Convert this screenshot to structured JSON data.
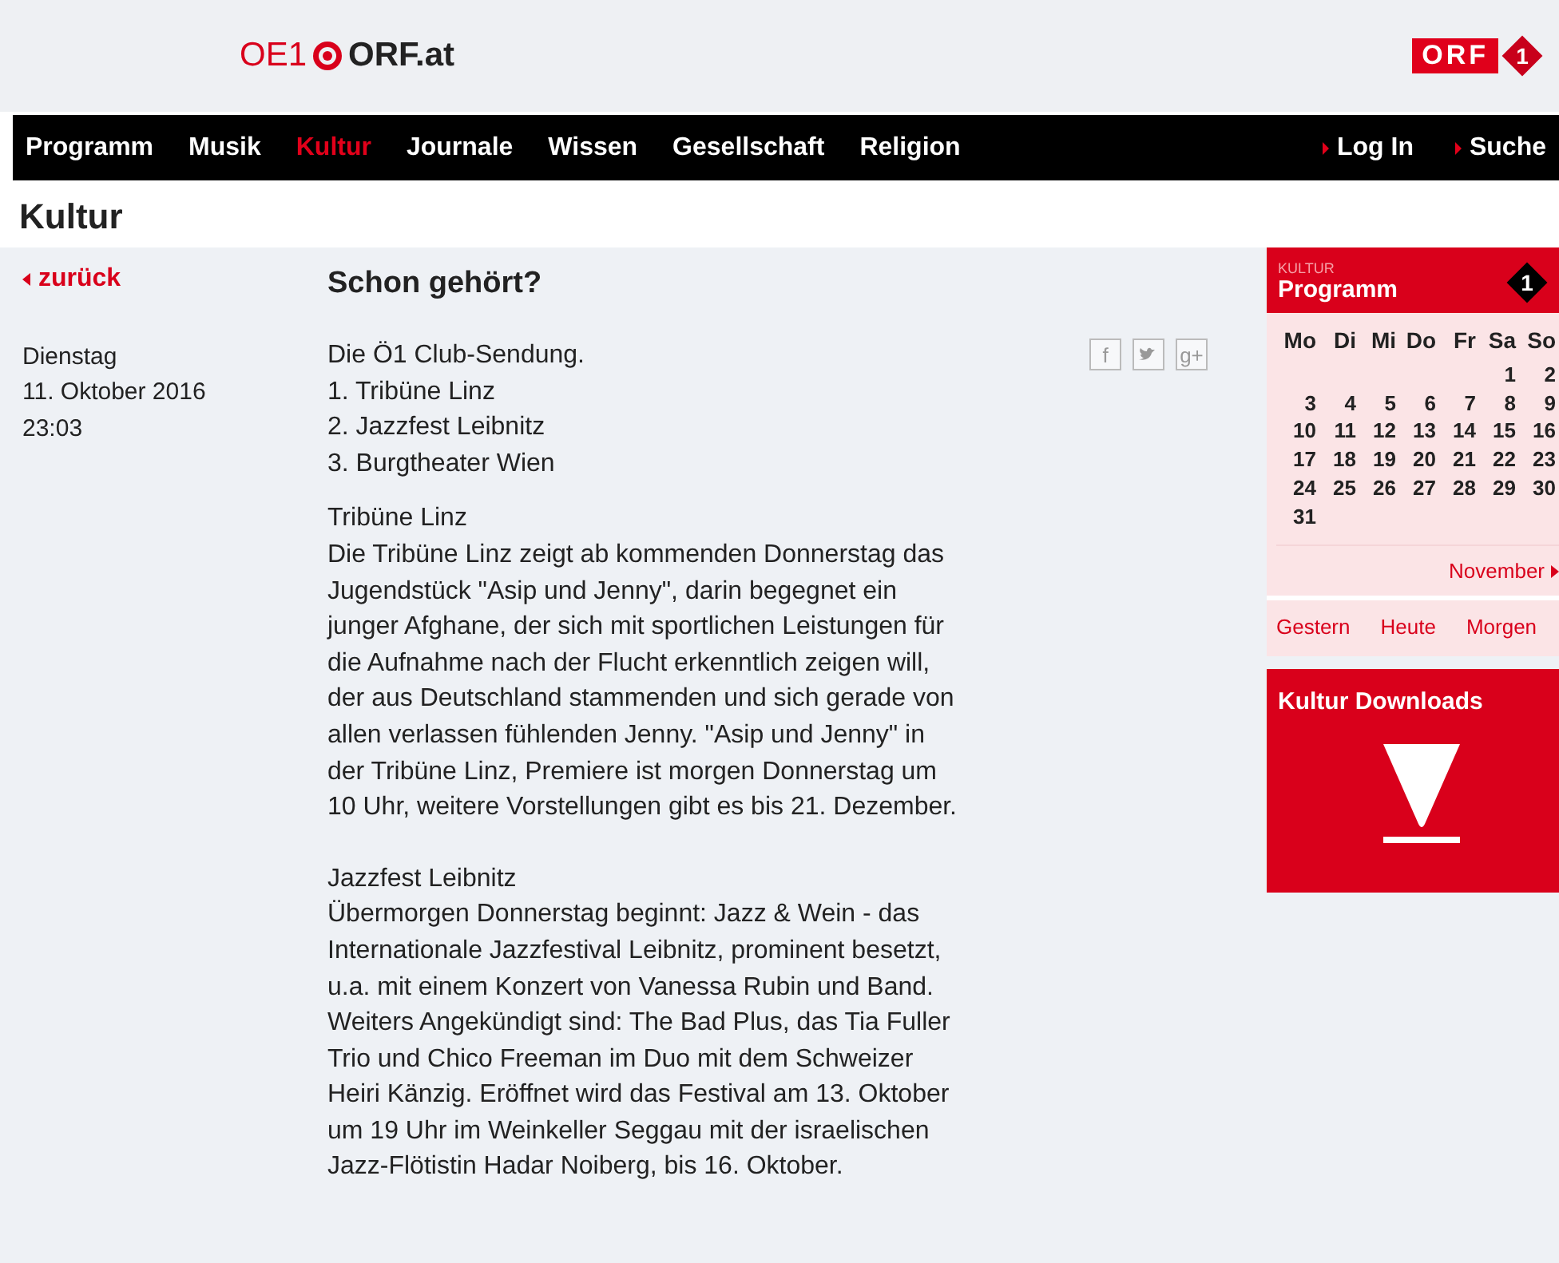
{
  "header": {
    "logo_left": "OE1",
    "logo_right": "ORF.at",
    "brand_badge": "ORF",
    "brand_number": "1"
  },
  "nav": {
    "items": [
      {
        "label": "Programm",
        "selected": false
      },
      {
        "label": "Musik",
        "selected": false
      },
      {
        "label": "Kultur",
        "selected": true
      },
      {
        "label": "Journale",
        "selected": false
      },
      {
        "label": "Wissen",
        "selected": false
      },
      {
        "label": "Gesellschaft",
        "selected": false
      },
      {
        "label": "Religion",
        "selected": false
      }
    ],
    "right_links": [
      "Log In",
      "Suche"
    ]
  },
  "page_title": "Kultur",
  "back_link": "zurück",
  "date": {
    "weekday": "Dienstag",
    "date": "11. Oktober 2016",
    "time": "23:03"
  },
  "article": {
    "title": "Schon gehört?",
    "intro": [
      "Die Ö1 Club-Sendung.",
      "1. Tribüne Linz",
      "2. Jazzfest Leibnitz",
      "3. Burgtheater Wien"
    ],
    "sections": [
      {
        "heading": "Tribüne Linz",
        "body": "Die Tribüne Linz zeigt ab kommenden Donnerstag das Jugendstück \"Asip und Jenny\", darin begegnet ein junger Afghane, der sich mit sportlichen Leistungen für die Aufnahme nach der Flucht erkenntlich zeigen will, der aus Deutschland stammenden und sich gerade von allen verlassen fühlenden Jenny. \"Asip und Jenny\" in der Tribüne Linz, Premiere ist morgen Donnerstag um 10 Uhr, weitere Vorstellungen gibt es bis 21. Dezember."
      },
      {
        "heading": "Jazzfest Leibnitz",
        "body": "Übermorgen Donnerstag beginnt: Jazz & Wein - das Internationale Jazzfestival Leibnitz, prominent besetzt, u.a. mit einem Konzert von Vanessa Rubin und Band. Weiters Angekündigt sind: The Bad Plus, das Tia Fuller Trio und Chico Freeman im Duo mit dem Schweizer Heiri Känzig. Eröffnet wird das Festival am 13. Oktober um 19 Uhr im Weinkeller Seggau mit der israelischen Jazz-Flötistin Hadar Noiberg, bis 16. Oktober."
      }
    ],
    "share": [
      {
        "kind": "facebook",
        "label": "f"
      },
      {
        "kind": "twitter"
      },
      {
        "kind": "googleplus",
        "label": "g+"
      }
    ]
  },
  "sidebar": {
    "program": {
      "kicker": "KULTUR",
      "title": "Programm",
      "badge": "1",
      "weekdays": [
        "Mo",
        "Di",
        "Mi",
        "Do",
        "Fr",
        "Sa",
        "So"
      ],
      "cells": [
        {
          "kind": "blank"
        },
        {
          "kind": "blank"
        },
        {
          "kind": "blank"
        },
        {
          "kind": "blank"
        },
        {
          "kind": "blank"
        },
        {
          "kind": "day",
          "label": "1"
        },
        {
          "kind": "day",
          "label": "2"
        },
        {
          "kind": "day",
          "label": "3"
        },
        {
          "kind": "day",
          "label": "4"
        },
        {
          "kind": "day",
          "label": "5"
        },
        {
          "kind": "day",
          "label": "6"
        },
        {
          "kind": "day",
          "label": "7"
        },
        {
          "kind": "day",
          "label": "8"
        },
        {
          "kind": "day",
          "label": "9"
        },
        {
          "kind": "day",
          "label": "10"
        },
        {
          "kind": "day",
          "label": "11"
        },
        {
          "kind": "day",
          "label": "12"
        },
        {
          "kind": "day",
          "label": "13"
        },
        {
          "kind": "day",
          "label": "14"
        },
        {
          "kind": "day",
          "label": "15"
        },
        {
          "kind": "day",
          "label": "16"
        },
        {
          "kind": "day",
          "label": "17"
        },
        {
          "kind": "day",
          "label": "18"
        },
        {
          "kind": "day",
          "label": "19"
        },
        {
          "kind": "day",
          "label": "20"
        },
        {
          "kind": "day",
          "label": "21"
        },
        {
          "kind": "day",
          "label": "22"
        },
        {
          "kind": "day",
          "label": "23"
        },
        {
          "kind": "day",
          "label": "24"
        },
        {
          "kind": "day",
          "label": "25"
        },
        {
          "kind": "day",
          "label": "26"
        },
        {
          "kind": "day",
          "label": "27"
        },
        {
          "kind": "day",
          "label": "28"
        },
        {
          "kind": "day",
          "label": "29"
        },
        {
          "kind": "day",
          "label": "30"
        },
        {
          "kind": "day",
          "label": "31"
        }
      ],
      "next_month": "November",
      "day_links": [
        "Gestern",
        "Heute",
        "Morgen"
      ]
    },
    "downloads": {
      "title": "Kultur Downloads"
    }
  }
}
